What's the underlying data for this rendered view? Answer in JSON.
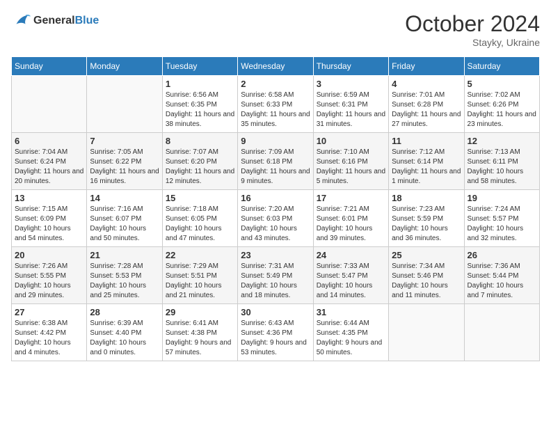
{
  "header": {
    "logo_line1": "General",
    "logo_line2": "Blue",
    "month": "October 2024",
    "location": "Stayky, Ukraine"
  },
  "days_of_week": [
    "Sunday",
    "Monday",
    "Tuesday",
    "Wednesday",
    "Thursday",
    "Friday",
    "Saturday"
  ],
  "weeks": [
    [
      {
        "day": "",
        "info": ""
      },
      {
        "day": "",
        "info": ""
      },
      {
        "day": "1",
        "info": "Sunrise: 6:56 AM\nSunset: 6:35 PM\nDaylight: 11 hours and 38 minutes."
      },
      {
        "day": "2",
        "info": "Sunrise: 6:58 AM\nSunset: 6:33 PM\nDaylight: 11 hours and 35 minutes."
      },
      {
        "day": "3",
        "info": "Sunrise: 6:59 AM\nSunset: 6:31 PM\nDaylight: 11 hours and 31 minutes."
      },
      {
        "day": "4",
        "info": "Sunrise: 7:01 AM\nSunset: 6:28 PM\nDaylight: 11 hours and 27 minutes."
      },
      {
        "day": "5",
        "info": "Sunrise: 7:02 AM\nSunset: 6:26 PM\nDaylight: 11 hours and 23 minutes."
      }
    ],
    [
      {
        "day": "6",
        "info": "Sunrise: 7:04 AM\nSunset: 6:24 PM\nDaylight: 11 hours and 20 minutes."
      },
      {
        "day": "7",
        "info": "Sunrise: 7:05 AM\nSunset: 6:22 PM\nDaylight: 11 hours and 16 minutes."
      },
      {
        "day": "8",
        "info": "Sunrise: 7:07 AM\nSunset: 6:20 PM\nDaylight: 11 hours and 12 minutes."
      },
      {
        "day": "9",
        "info": "Sunrise: 7:09 AM\nSunset: 6:18 PM\nDaylight: 11 hours and 9 minutes."
      },
      {
        "day": "10",
        "info": "Sunrise: 7:10 AM\nSunset: 6:16 PM\nDaylight: 11 hours and 5 minutes."
      },
      {
        "day": "11",
        "info": "Sunrise: 7:12 AM\nSunset: 6:14 PM\nDaylight: 11 hours and 1 minute."
      },
      {
        "day": "12",
        "info": "Sunrise: 7:13 AM\nSunset: 6:11 PM\nDaylight: 10 hours and 58 minutes."
      }
    ],
    [
      {
        "day": "13",
        "info": "Sunrise: 7:15 AM\nSunset: 6:09 PM\nDaylight: 10 hours and 54 minutes."
      },
      {
        "day": "14",
        "info": "Sunrise: 7:16 AM\nSunset: 6:07 PM\nDaylight: 10 hours and 50 minutes."
      },
      {
        "day": "15",
        "info": "Sunrise: 7:18 AM\nSunset: 6:05 PM\nDaylight: 10 hours and 47 minutes."
      },
      {
        "day": "16",
        "info": "Sunrise: 7:20 AM\nSunset: 6:03 PM\nDaylight: 10 hours and 43 minutes."
      },
      {
        "day": "17",
        "info": "Sunrise: 7:21 AM\nSunset: 6:01 PM\nDaylight: 10 hours and 39 minutes."
      },
      {
        "day": "18",
        "info": "Sunrise: 7:23 AM\nSunset: 5:59 PM\nDaylight: 10 hours and 36 minutes."
      },
      {
        "day": "19",
        "info": "Sunrise: 7:24 AM\nSunset: 5:57 PM\nDaylight: 10 hours and 32 minutes."
      }
    ],
    [
      {
        "day": "20",
        "info": "Sunrise: 7:26 AM\nSunset: 5:55 PM\nDaylight: 10 hours and 29 minutes."
      },
      {
        "day": "21",
        "info": "Sunrise: 7:28 AM\nSunset: 5:53 PM\nDaylight: 10 hours and 25 minutes."
      },
      {
        "day": "22",
        "info": "Sunrise: 7:29 AM\nSunset: 5:51 PM\nDaylight: 10 hours and 21 minutes."
      },
      {
        "day": "23",
        "info": "Sunrise: 7:31 AM\nSunset: 5:49 PM\nDaylight: 10 hours and 18 minutes."
      },
      {
        "day": "24",
        "info": "Sunrise: 7:33 AM\nSunset: 5:47 PM\nDaylight: 10 hours and 14 minutes."
      },
      {
        "day": "25",
        "info": "Sunrise: 7:34 AM\nSunset: 5:46 PM\nDaylight: 10 hours and 11 minutes."
      },
      {
        "day": "26",
        "info": "Sunrise: 7:36 AM\nSunset: 5:44 PM\nDaylight: 10 hours and 7 minutes."
      }
    ],
    [
      {
        "day": "27",
        "info": "Sunrise: 6:38 AM\nSunset: 4:42 PM\nDaylight: 10 hours and 4 minutes."
      },
      {
        "day": "28",
        "info": "Sunrise: 6:39 AM\nSunset: 4:40 PM\nDaylight: 10 hours and 0 minutes."
      },
      {
        "day": "29",
        "info": "Sunrise: 6:41 AM\nSunset: 4:38 PM\nDaylight: 9 hours and 57 minutes."
      },
      {
        "day": "30",
        "info": "Sunrise: 6:43 AM\nSunset: 4:36 PM\nDaylight: 9 hours and 53 minutes."
      },
      {
        "day": "31",
        "info": "Sunrise: 6:44 AM\nSunset: 4:35 PM\nDaylight: 9 hours and 50 minutes."
      },
      {
        "day": "",
        "info": ""
      },
      {
        "day": "",
        "info": ""
      }
    ]
  ]
}
